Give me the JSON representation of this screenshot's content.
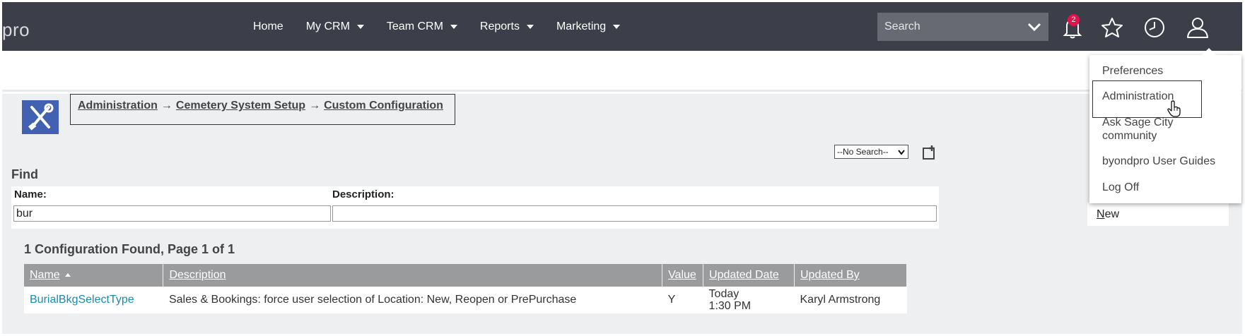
{
  "topbar": {
    "logo_text": "pro",
    "nav": [
      {
        "label": "Home",
        "has_caret": false
      },
      {
        "label": "My CRM",
        "has_caret": true
      },
      {
        "label": "Team CRM",
        "has_caret": true
      },
      {
        "label": "Reports",
        "has_caret": true
      },
      {
        "label": "Marketing",
        "has_caret": true
      }
    ],
    "search_placeholder": "Search",
    "notification_count": "2",
    "icons": [
      "bell-icon",
      "star-icon",
      "clock-icon",
      "user-icon"
    ]
  },
  "breadcrumb": {
    "items": [
      "Administration",
      "Cemetery System Setup",
      "Custom Configuration"
    ],
    "separator": "→"
  },
  "saved_search": {
    "selected": "--No Search--"
  },
  "find": {
    "title": "Find",
    "name_label": "Name:",
    "name_value": "bur",
    "description_label": "Description:",
    "description_value": ""
  },
  "results": {
    "summary": "1 Configuration Found, Page 1 of 1",
    "columns": [
      "Name",
      "Description",
      "Value",
      "Updated Date",
      "Updated By"
    ],
    "rows": [
      {
        "name": "BurialBkgSelectType",
        "description": "Sales & Bookings: force user selection of Location: New, Reopen or PrePurchase",
        "value": "Y",
        "updated_date_line1": "Today",
        "updated_date_line2": "1:30 PM",
        "updated_by": "Karyl Armstrong"
      }
    ]
  },
  "side_actions": {
    "new_first_letter": "N",
    "new_rest": "ew"
  },
  "user_menu": {
    "items": [
      "Preferences",
      "Administration",
      "Ask Sage City community",
      "byondpro User Guides",
      "Log Off"
    ],
    "highlighted": "Administration"
  },
  "colors": {
    "topbar": "#3c3f4a",
    "admin_icon_bg": "#4261b3",
    "link": "#1a8cab",
    "header_grey": "#9a9b9d",
    "badge": "#e5114b"
  }
}
